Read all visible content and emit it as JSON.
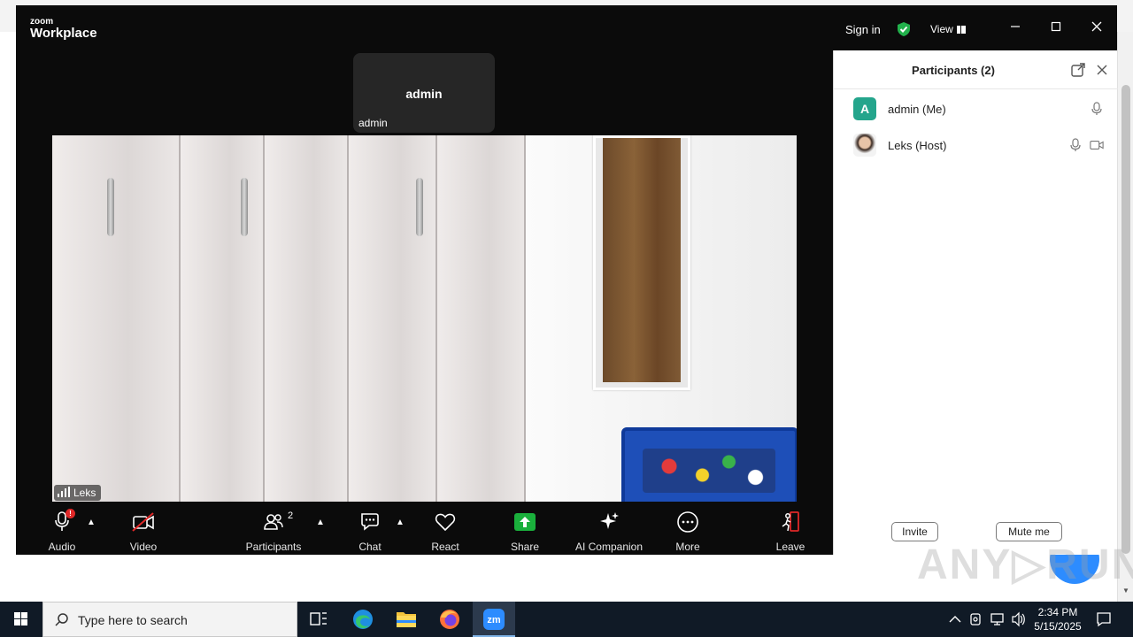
{
  "window": {
    "logo_small": "zoom",
    "logo_big": "Workplace",
    "sign_in": "Sign in",
    "view": "View"
  },
  "stage": {
    "self_tile_name": "admin",
    "self_tile_label": "admin",
    "main_video_label": "Leks"
  },
  "toolbar": {
    "audio": "Audio",
    "audio_badge": "!",
    "video": "Video",
    "participants": "Participants",
    "participants_count": "2",
    "chat": "Chat",
    "react": "React",
    "share": "Share",
    "ai_companion": "AI Companion",
    "more": "More",
    "leave": "Leave"
  },
  "panel": {
    "title": "Participants (2)",
    "participants": [
      {
        "avatar_letter": "A",
        "name": "admin (Me)"
      },
      {
        "avatar_letter": "",
        "name": "Leks (Host)"
      }
    ],
    "invite": "Invite",
    "mute_me": "Mute me"
  },
  "taskbar": {
    "search_placeholder": "Type here to search",
    "time": "2:34 PM",
    "date": "5/15/2025"
  },
  "colors": {
    "share_green": "#1ab03c",
    "leave_red": "#e02828",
    "avatar_teal": "#24a58c",
    "shield_green": "#22b14c"
  }
}
